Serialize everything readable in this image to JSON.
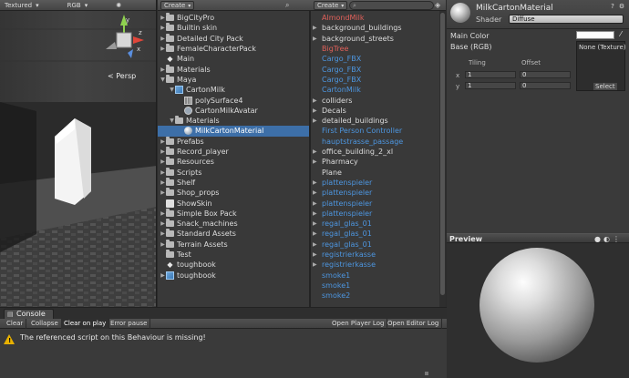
{
  "scene": {
    "toolbar": {
      "render_mode": "Textured",
      "channel": "RGB"
    },
    "persp_label": "< Persp",
    "gizmo": {
      "y": "y",
      "x": "x",
      "z": "z"
    }
  },
  "project": {
    "create_label": "Create",
    "tree": [
      {
        "label": "BigCityPro",
        "icon": "folder-icon",
        "indent": 0,
        "tri": "▶"
      },
      {
        "label": "Builtin skin",
        "icon": "folder-icon",
        "indent": 0,
        "tri": "▶"
      },
      {
        "label": "Detailed City Pack",
        "icon": "folder-icon",
        "indent": 0,
        "tri": "▶"
      },
      {
        "label": "FemaleCharacterPack",
        "icon": "folder-icon",
        "indent": 0,
        "tri": "▶"
      },
      {
        "label": "Main",
        "icon": "unity-scene-icon",
        "indent": 0,
        "tri": ""
      },
      {
        "label": "Materials",
        "icon": "folder-icon",
        "indent": 0,
        "tri": "▶"
      },
      {
        "label": "Maya",
        "icon": "folder-icon",
        "indent": 0,
        "tri": "▼"
      },
      {
        "label": "CartonMilk",
        "icon": "cube-icon",
        "indent": 1,
        "tri": "▼"
      },
      {
        "label": "polySurface4",
        "icon": "mesh-icon",
        "indent": 2,
        "tri": ""
      },
      {
        "label": "CartonMilkAvatar",
        "icon": "avatar-icon",
        "indent": 2,
        "tri": ""
      },
      {
        "label": "Materials",
        "icon": "folder-icon",
        "indent": 1,
        "tri": "▼"
      },
      {
        "label": "MilkCartonMaterial",
        "icon": "material-icon",
        "indent": 2,
        "tri": "",
        "selected": true
      },
      {
        "label": "Prefabs",
        "icon": "folder-icon",
        "indent": 0,
        "tri": "▶"
      },
      {
        "label": "Record_player",
        "icon": "folder-icon",
        "indent": 0,
        "tri": "▶"
      },
      {
        "label": "Resources",
        "icon": "folder-icon",
        "indent": 0,
        "tri": "▶"
      },
      {
        "label": "Scripts",
        "icon": "folder-icon",
        "indent": 0,
        "tri": "▶"
      },
      {
        "label": "Shelf",
        "icon": "folder-icon",
        "indent": 0,
        "tri": "▶"
      },
      {
        "label": "Shop_props",
        "icon": "folder-icon",
        "indent": 0,
        "tri": "▶"
      },
      {
        "label": "ShowSkin",
        "icon": "skin-icon",
        "indent": 0,
        "tri": ""
      },
      {
        "label": "Simple Box Pack",
        "icon": "folder-icon",
        "indent": 0,
        "tri": "▶"
      },
      {
        "label": "Snack_machines",
        "icon": "folder-icon",
        "indent": 0,
        "tri": "▶"
      },
      {
        "label": "Standard Assets",
        "icon": "folder-icon",
        "indent": 0,
        "tri": "▶"
      },
      {
        "label": "Terrain Assets",
        "icon": "folder-icon",
        "indent": 0,
        "tri": "▶"
      },
      {
        "label": "Test",
        "icon": "folder-icon",
        "indent": 0,
        "tri": ""
      },
      {
        "label": "toughbook",
        "icon": "unity-scene-icon",
        "indent": 0,
        "tri": ""
      },
      {
        "label": "toughbook",
        "icon": "cube-icon",
        "indent": 0,
        "tri": "▶"
      }
    ],
    "assets": [
      {
        "label": "AlmondMilk",
        "color": "red",
        "tri": ""
      },
      {
        "label": "background_buildings",
        "color": "white",
        "tri": "▶"
      },
      {
        "label": "background_streets",
        "color": "white",
        "tri": "▶"
      },
      {
        "label": "BigTree",
        "color": "red",
        "tri": ""
      },
      {
        "label": "Cargo_FBX",
        "color": "blue",
        "tri": ""
      },
      {
        "label": "Cargo_FBX",
        "color": "blue",
        "tri": ""
      },
      {
        "label": "Cargo_FBX",
        "color": "blue",
        "tri": ""
      },
      {
        "label": "CartonMilk",
        "color": "blue",
        "tri": ""
      },
      {
        "label": "colliders",
        "color": "white",
        "tri": "▶"
      },
      {
        "label": "Decals",
        "color": "white",
        "tri": "▶"
      },
      {
        "label": "detailed_buildings",
        "color": "white",
        "tri": "▶"
      },
      {
        "label": "First Person Controller",
        "color": "blue",
        "tri": ""
      },
      {
        "label": "hauptstrasse_passage",
        "color": "blue",
        "tri": ""
      },
      {
        "label": "office_building_2_xl",
        "color": "white",
        "tri": "▶"
      },
      {
        "label": "Pharmacy",
        "color": "white",
        "tri": "▶"
      },
      {
        "label": "Plane",
        "color": "white",
        "tri": ""
      },
      {
        "label": "plattenspieler",
        "color": "blue",
        "tri": "▶"
      },
      {
        "label": "plattenspieler",
        "color": "blue",
        "tri": "▶"
      },
      {
        "label": "plattenspieler",
        "color": "blue",
        "tri": "▶"
      },
      {
        "label": "plattenspieler",
        "color": "blue",
        "tri": "▶"
      },
      {
        "label": "regal_glas_01",
        "color": "blue",
        "tri": "▶"
      },
      {
        "label": "regal_glas_01",
        "color": "blue",
        "tri": "▶"
      },
      {
        "label": "regal_glas_01",
        "color": "blue",
        "tri": "▶"
      },
      {
        "label": "registrierkasse",
        "color": "blue",
        "tri": "▶"
      },
      {
        "label": "registrierkasse",
        "color": "blue",
        "tri": "▶"
      },
      {
        "label": "smoke1",
        "color": "blue",
        "tri": ""
      },
      {
        "label": "smoke1",
        "color": "blue",
        "tri": ""
      },
      {
        "label": "smoke2",
        "color": "blue",
        "tri": ""
      }
    ]
  },
  "inspector": {
    "material_name": "MilkCartonMaterial",
    "shader_label": "Shader",
    "shader_value": "Diffuse",
    "main_color_label": "Main Color",
    "main_color": "#ffffff",
    "base_label": "Base (RGB)",
    "texture_none": "None (Texture)",
    "texture_select": "Select",
    "tiling_label": "Tiling",
    "offset_label": "Offset",
    "x_label": "x",
    "y_label": "y",
    "tiling_x": "1",
    "tiling_y": "1",
    "offset_x": "0",
    "offset_y": "0"
  },
  "preview": {
    "title": "Preview"
  },
  "console": {
    "tab_label": "Console",
    "buttons": {
      "clear": "Clear",
      "collapse": "Collapse",
      "clear_on_play": "Clear on play",
      "error_pause": "Error pause",
      "open_player_log": "Open Player Log",
      "open_editor_log": "Open Editor Log"
    },
    "message": "The referenced script on this Behaviour is missing!"
  },
  "colors": {
    "selection": "#3d6fa8",
    "link_blue": "#4d96e0",
    "missing_red": "#e0605a",
    "warning_yellow": "#e8b100"
  }
}
